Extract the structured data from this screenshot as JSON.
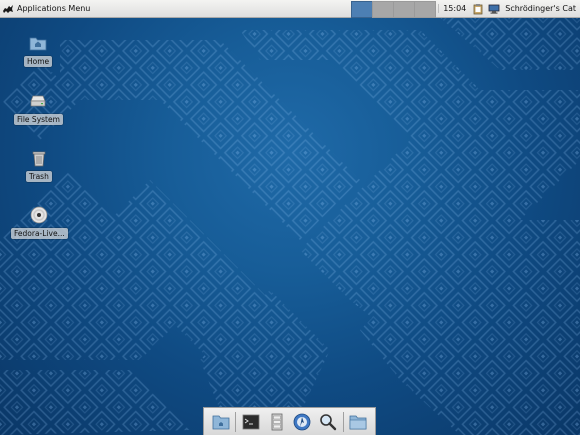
{
  "top_panel": {
    "app_menu_label": "Applications Menu",
    "clock": "15:04",
    "user": "Schrödinger's Cat",
    "workspaces": [
      "active",
      "idle",
      "idle",
      "idle"
    ]
  },
  "desktop": {
    "icons": [
      {
        "label": "Home",
        "icon": "home-folder-icon"
      },
      {
        "label": "File System",
        "icon": "drive-icon"
      },
      {
        "label": "Trash",
        "icon": "trash-icon"
      },
      {
        "label": "Fedora-Live...",
        "icon": "disc-icon"
      }
    ]
  },
  "dock": {
    "items": [
      "home-folder-icon",
      "terminal-icon",
      "file-manager-icon",
      "browser-icon",
      "search-icon",
      "folder-icon"
    ]
  },
  "colors": {
    "desktop": "#175d98",
    "panel": "#e8e8e8",
    "workspace_active": "#4d7fb3"
  }
}
